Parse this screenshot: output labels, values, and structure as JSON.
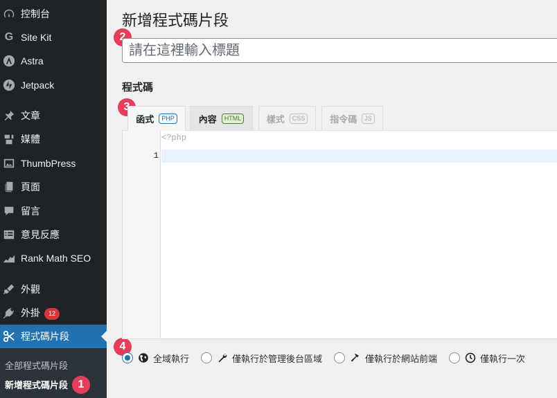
{
  "sidebar": {
    "items": [
      {
        "label": "控制台",
        "icon": "dashboard-icon"
      },
      {
        "label": "Site Kit",
        "icon": "site-kit-icon"
      },
      {
        "label": "Astra",
        "icon": "astra-icon"
      },
      {
        "label": "Jetpack",
        "icon": "jetpack-icon"
      },
      {
        "label": "文章",
        "icon": "pin-icon"
      },
      {
        "label": "媒體",
        "icon": "media-icon"
      },
      {
        "label": "ThumbPress",
        "icon": "image-icon"
      },
      {
        "label": "頁面",
        "icon": "pages-icon"
      },
      {
        "label": "留言",
        "icon": "comment-icon"
      },
      {
        "label": "意見反應",
        "icon": "feedback-icon"
      },
      {
        "label": "Rank Math SEO",
        "icon": "rank-math-icon"
      },
      {
        "label": "外觀",
        "icon": "brush-icon"
      },
      {
        "label": "外掛",
        "icon": "plugin-icon",
        "badge": "12"
      },
      {
        "label": "程式碼片段",
        "icon": "scissors-icon",
        "active": true
      }
    ],
    "submenu": [
      {
        "label": "全部程式碼片段"
      },
      {
        "label": "新增程式碼片段",
        "current": true
      }
    ]
  },
  "markers": [
    "1",
    "2",
    "3",
    "4"
  ],
  "main": {
    "title": "新增程式碼片段",
    "title_placeholder": "請在這裡輸入標題",
    "code_section_label": "程式碼",
    "tabs": [
      {
        "label": "函式",
        "tag": "PHP"
      },
      {
        "label": "內容",
        "tag": "HTML"
      },
      {
        "label": "樣式",
        "tag": "CSS"
      },
      {
        "label": "指令碼",
        "tag": "JS"
      }
    ],
    "editor": {
      "php_open_tag": "<?php",
      "line_number": "1"
    },
    "scope_options": [
      {
        "label": "全域執行",
        "icon": "globe-icon",
        "checked": true
      },
      {
        "label": "僅執行於管理後台區域",
        "icon": "wrench-icon"
      },
      {
        "label": "僅執行於網站前端",
        "icon": "hammer-icon"
      },
      {
        "label": "僅執行一次",
        "icon": "clock-icon"
      }
    ]
  },
  "colors": {
    "sidebar_bg": "#1d2327",
    "accent": "#2271b1",
    "marker": "#e63e5a",
    "badge": "#d63638"
  }
}
